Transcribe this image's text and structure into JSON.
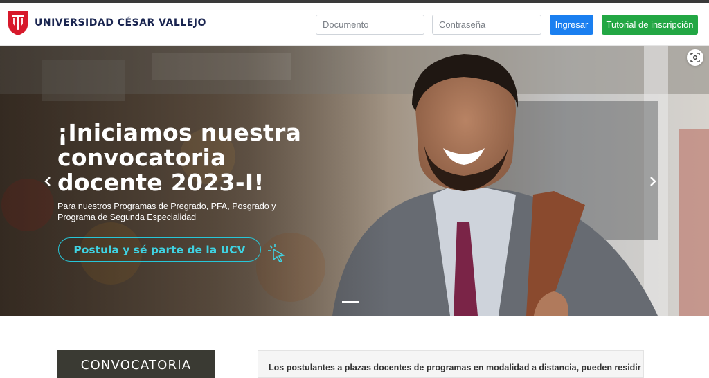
{
  "header": {
    "logo_text": "UNIVERSIDAD CÉSAR VALLEJO",
    "logo_icon": "ucv-shield-logo",
    "document_placeholder": "Documento",
    "password_placeholder": "Contraseña",
    "login_label": "Ingresar",
    "tutorial_label": "Tutorial de inscripción",
    "colors": {
      "login": "#1a7ff0",
      "tutorial": "#22a744",
      "brand_red": "#d7192b",
      "brand_navy": "#1a2550"
    }
  },
  "hero": {
    "title": "¡Iniciamos nuestra convocatoria docente 2023-I!",
    "subtitle": "Para nuestros Programas de Pregrado, PFA, Posgrado y Programa de Segunda Especialidad",
    "cta_label": "Postula y sé parte de la UCV",
    "cta_color": "#27c6d8",
    "prev_icon": "chevron-left-icon",
    "next_icon": "chevron-right-icon",
    "zoom_icon": "visual-search-icon"
  },
  "lower": {
    "section_label": "CONVOCATORIA",
    "notice_text": "Los postulantes a plazas docentes de programas en modalidad a distancia, pueden residir"
  }
}
